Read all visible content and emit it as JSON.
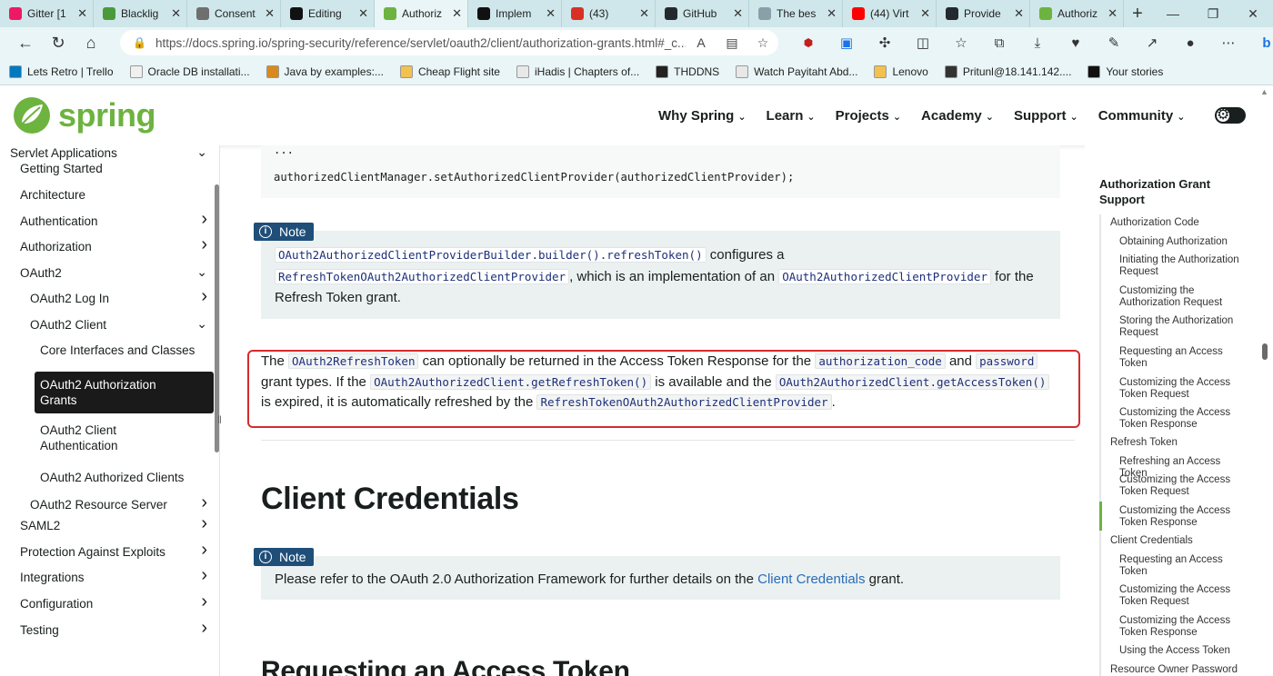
{
  "browser": {
    "tabs": [
      {
        "label": "Gitter [1",
        "color": "#ed1965"
      },
      {
        "label": "Blacklig",
        "color": "#4a9a3b"
      },
      {
        "label": "Consent",
        "color": "#6f6f6f"
      },
      {
        "label": "Editing",
        "color": "#111111"
      },
      {
        "label": "Authoriz",
        "color": "#6db33f"
      },
      {
        "label": "Implem",
        "color": "#111111"
      },
      {
        "label": "(43)",
        "color": "#d93025"
      },
      {
        "label": "GitHub",
        "color": "#24292e"
      },
      {
        "label": "The bes",
        "color": "#8aa0a8"
      },
      {
        "label": "(44) Virt",
        "color": "#ff0000"
      },
      {
        "label": "Provide",
        "color": "#24292e"
      },
      {
        "label": "Authoriz",
        "color": "#6db33f"
      }
    ],
    "url": "https://docs.spring.io/spring-security/reference/servlet/oauth2/client/authorization-grants.html#_c...",
    "bookmarks": [
      {
        "label": "Lets Retro | Trello",
        "color": "#0079bf"
      },
      {
        "label": "Oracle DB installati...",
        "color": "#f0f0f0"
      },
      {
        "label": "Java by examples:...",
        "color": "#d98a1f"
      },
      {
        "label": "Cheap Flight site",
        "color": "#f2c14e"
      },
      {
        "label": "iHadis | Chapters of...",
        "color": "#e8e8e8"
      },
      {
        "label": "THDDNS",
        "color": "#222222"
      },
      {
        "label": "Watch Payitaht Abd...",
        "color": "#e8e8e8"
      },
      {
        "label": "Lenovo",
        "color": "#f2c14e"
      },
      {
        "label": "Pritunl@18.141.142....",
        "color": "#333333"
      },
      {
        "label": "Your stories",
        "color": "#111111"
      }
    ]
  },
  "site": {
    "logo": "spring",
    "brand_color": "#6db33f",
    "nav": [
      "Why Spring",
      "Learn",
      "Projects",
      "Academy",
      "Support",
      "Community"
    ]
  },
  "sidebar": {
    "items": [
      {
        "label": "Servlet Applications",
        "chev": "⌄"
      },
      {
        "label": "Getting Started",
        "chev": ""
      },
      {
        "label": "Architecture",
        "chev": ""
      },
      {
        "label": "Authentication",
        "chev": "›"
      },
      {
        "label": "Authorization",
        "chev": "›"
      },
      {
        "label": "OAuth2",
        "chev": "⌄"
      },
      {
        "label": "OAuth2 Log In",
        "chev": "›"
      },
      {
        "label": "OAuth2 Client",
        "chev": "⌄"
      },
      {
        "label": "Core Interfaces and Classes",
        "chev": ""
      },
      {
        "label": "OAuth2 Authorization Grants",
        "chev": ""
      },
      {
        "label": "OAuth2 Client Authentication",
        "chev": ""
      },
      {
        "label": "OAuth2 Authorized Clients",
        "chev": ""
      },
      {
        "label": "OAuth2 Resource Server",
        "chev": "›"
      },
      {
        "label": "SAML2",
        "chev": "›"
      },
      {
        "label": "Protection Against Exploits",
        "chev": "›"
      },
      {
        "label": "Integrations",
        "chev": "›"
      },
      {
        "label": "Configuration",
        "chev": "›"
      },
      {
        "label": "Testing",
        "chev": "›"
      }
    ]
  },
  "content": {
    "code_ellipsis": "...",
    "code_line": "authorizedClientManager.setAuthorizedClientProvider(authorizedClientProvider);",
    "note_label": "Note",
    "note1": {
      "code1": "OAuth2AuthorizedClientProviderBuilder.builder().refreshToken()",
      "t1": " configures a ",
      "code2": "RefreshTokenOAuth2AuthorizedClientProvider",
      "t2": ", which is an implementation of an ",
      "code3": "OAuth2AuthorizedClientProvider",
      "t3": " for the Refresh Token grant."
    },
    "para1": {
      "t0": "The ",
      "code1": "OAuth2RefreshToken",
      "t1": " can optionally be returned in the Access Token Response for the ",
      "code2": "authorization_code",
      "t2": " and ",
      "code3": "password",
      "t3": " grant types. If the ",
      "code4": "OAuth2AuthorizedClient.getRefreshToken()",
      "t4": " is available and the ",
      "code5": "OAuth2AuthorizedClient.getAccessToken()",
      "t5": " is expired, it is automatically refreshed by the ",
      "code6": "RefreshTokenOAuth2AuthorizedClientProvider",
      "t6": "."
    },
    "heading1": "Client Credentials",
    "note2": {
      "t0": "Please refer to the OAuth 2.0 Authorization Framework for further details on the ",
      "link": "Client Credentials",
      "t1": " grant."
    },
    "heading2": "Requesting an Access Token"
  },
  "toc": {
    "title": "Authorization Grant Support",
    "items": [
      {
        "label": "Authorization Code",
        "level": 1
      },
      {
        "label": "Obtaining Authorization",
        "level": 2
      },
      {
        "label": "Initiating the Authorization Request",
        "level": 2
      },
      {
        "label": "Customizing the Authorization Request",
        "level": 2
      },
      {
        "label": "Storing the Authorization Request",
        "level": 2
      },
      {
        "label": "Requesting an Access Token",
        "level": 2
      },
      {
        "label": "Customizing the Access Token Request",
        "level": 2
      },
      {
        "label": "Customizing the Access Token Response",
        "level": 2
      },
      {
        "label": "Refresh Token",
        "level": 1
      },
      {
        "label": "Refreshing an Access Token",
        "level": 2
      },
      {
        "label": "Customizing the Access Token Request",
        "level": 2
      },
      {
        "label": "Customizing the Access Token Response",
        "level": 2
      },
      {
        "label": "Client Credentials",
        "level": 1
      },
      {
        "label": "Requesting an Access Token",
        "level": 2
      },
      {
        "label": "Customizing the Access Token Request",
        "level": 2
      },
      {
        "label": "Customizing the Access Token Response",
        "level": 2
      },
      {
        "label": "Using the Access Token",
        "level": 2
      },
      {
        "label": "Resource Owner Password",
        "level": 1
      }
    ]
  }
}
